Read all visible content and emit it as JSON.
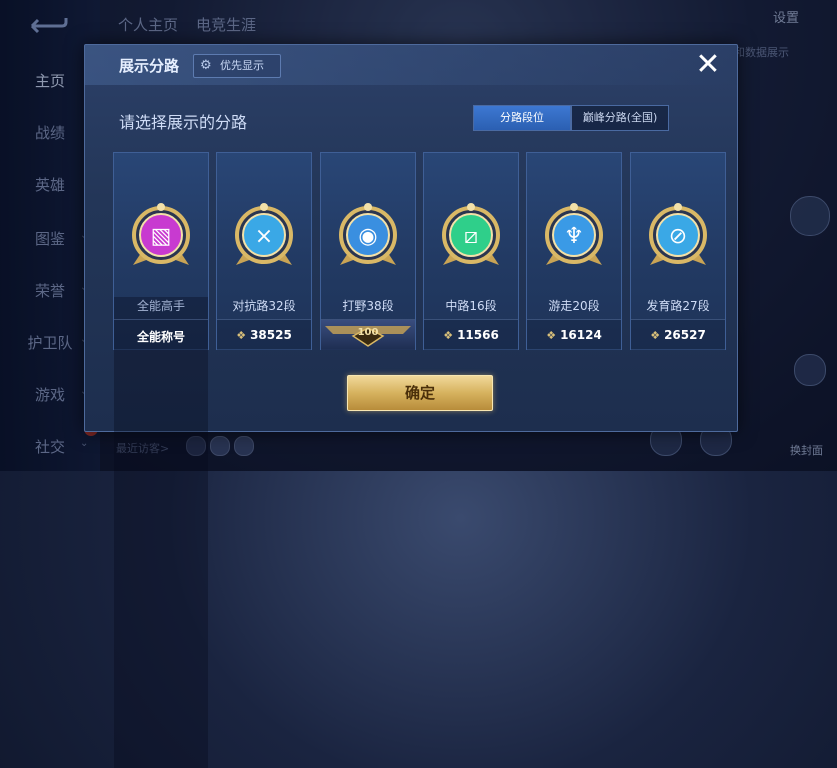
{
  "background": {
    "sidebar": [
      {
        "label": "主页",
        "active": true
      },
      {
        "label": "战绩"
      },
      {
        "label": "英雄"
      },
      {
        "label": "图鉴",
        "chevron": true,
        "new": true
      },
      {
        "label": "荣誉",
        "chevron": true,
        "new": true
      },
      {
        "label": "护卫队",
        "chevron": true
      },
      {
        "label": "游戏",
        "chevron": true
      },
      {
        "label": "社交",
        "chevron": true,
        "new": true
      }
    ],
    "new_tag": "新",
    "top_tabs": [
      "个人主页",
      "电竞生涯"
    ],
    "settings_label": "设置",
    "hint_text": "和数据展示",
    "recent_visitors_label": "最近访客>",
    "cover_label": "换封面"
  },
  "dialog": {
    "title": "展示分路",
    "priority_label": "优先显示",
    "close_icon": "close-icon",
    "subtitle": "请选择展示的分路",
    "segments": [
      {
        "label": "分路段位",
        "selected": true
      },
      {
        "label": "巅峰分路(全国)",
        "selected": false
      }
    ],
    "cards": [
      {
        "rank": "全能高手",
        "footer": "全能称号",
        "footer_type": "text",
        "emblem_color": "#c83ad0",
        "emblem_glyph": "▧"
      },
      {
        "rank": "对抗路32段",
        "footer": "38525",
        "footer_type": "score",
        "emblem_color": "#3aa8e6",
        "emblem_glyph": "⨯"
      },
      {
        "rank": "打野38段",
        "footer": "100",
        "footer_type": "badge",
        "emblem_color": "#3a8fe0",
        "emblem_glyph": "◉"
      },
      {
        "rank": "中路16段",
        "footer": "11566",
        "footer_type": "score",
        "emblem_color": "#2fcf8a",
        "emblem_glyph": "⧄"
      },
      {
        "rank": "游走20段",
        "footer": "16124",
        "footer_type": "score",
        "emblem_color": "#3a9ae6",
        "emblem_glyph": "♆"
      },
      {
        "rank": "发育路27段",
        "footer": "26527",
        "footer_type": "score",
        "emblem_color": "#3aa8e6",
        "emblem_glyph": "⊘"
      }
    ],
    "confirm_label": "确定"
  },
  "colors": {
    "accent_blue": "#2b5fb2",
    "gold": "#d6b25e"
  }
}
